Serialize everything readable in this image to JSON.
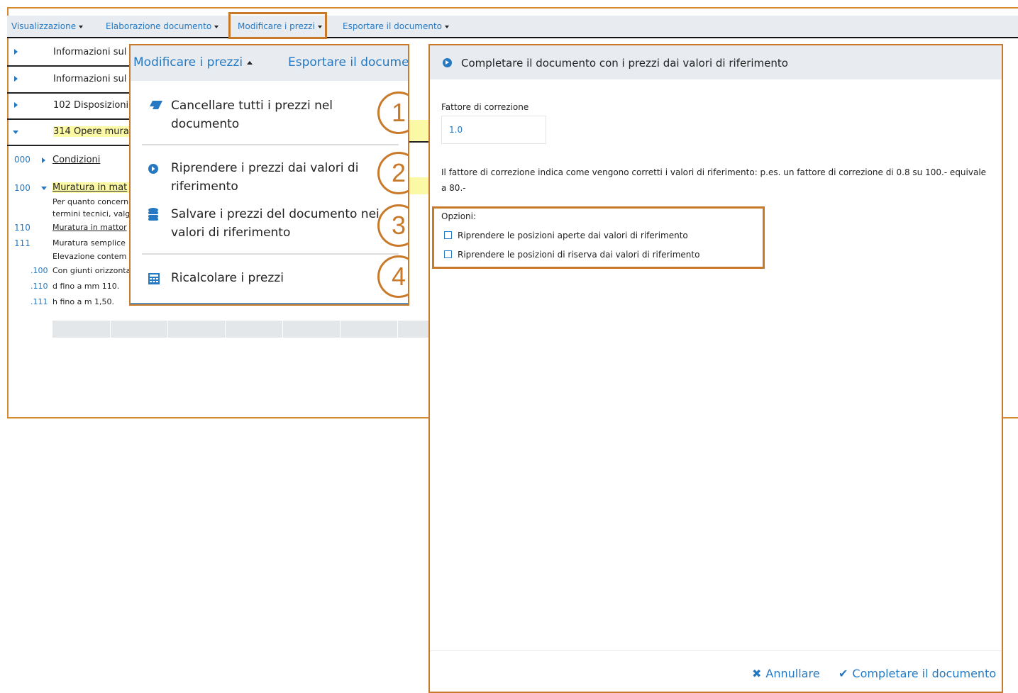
{
  "menubar": {
    "items": [
      {
        "label": "Visualizzazione"
      },
      {
        "label": "Elaborazione documento"
      },
      {
        "label": "Modificare i prezzi"
      },
      {
        "label": "Esportare il documento"
      }
    ]
  },
  "tree": {
    "rows": [
      {
        "label": "Informazioni sul"
      },
      {
        "label": "Informazioni sul"
      },
      {
        "label": "102 Disposizioni"
      },
      {
        "label": "314 Opere mura"
      }
    ],
    "positions": {
      "p000": {
        "code": "000",
        "text": "Condizioni"
      },
      "p100": {
        "code": "100",
        "text": "Muratura in mat",
        "desc1": "Per quanto concern",
        "desc2": "termini tecnici, valg"
      },
      "p110": {
        "code": "110",
        "text": "Muratura in mattor"
      },
      "p111": {
        "code": "111",
        "text": "Muratura semplice",
        "desc": "Elevazione contem"
      },
      "s100": {
        "code": ".100",
        "text": "Con giunti orizzonta"
      },
      "s110": {
        "code": ".110",
        "text": "d fino a mm 110."
      },
      "s111": {
        "code": ".111",
        "text": "h fino a m 1,50."
      }
    }
  },
  "dropdown": {
    "title": "Modificare i prezzi",
    "other": "Esportare il docume",
    "items": [
      {
        "line1": "Cancellare tutti i prezzi nel",
        "line2": "documento",
        "icon": "eraser-icon",
        "badge": "1"
      },
      {
        "line1": "Riprendere i prezzi dai valori di",
        "line2": "riferimento",
        "icon": "circle-arrow-right-icon",
        "badge": "2"
      },
      {
        "line1": "Salvare i prezzi del documento nei",
        "line2": "valori di riferimento",
        "icon": "database-icon",
        "badge": "3"
      },
      {
        "line1": "Ricalcolare i prezzi",
        "icon": "calculator-icon",
        "badge": "4"
      }
    ]
  },
  "dialog": {
    "title": "Completare il documento con i prezzi dai valori di riferimento",
    "factor_label": "Fattore di correzione",
    "factor_value": "1.0",
    "factor_help": "Il fattore di correzione indica come vengono corretti i valori di riferimento: p.es. un fattore di correzione di 0.8 su 100.- equivale a 80.-",
    "options_label": "Opzioni:",
    "option1": "Riprendere le posizioni aperte dai valori di riferimento",
    "option2": "Riprendere le posizioni di riserva dai valori di riferimento",
    "cancel": "Annullare",
    "confirm": "Completare il documento"
  },
  "colors": {
    "accent": "#2479c2",
    "highlight": "#c87a2a",
    "header_bg": "#e8ecf1",
    "mark": "#fbf9a6"
  }
}
